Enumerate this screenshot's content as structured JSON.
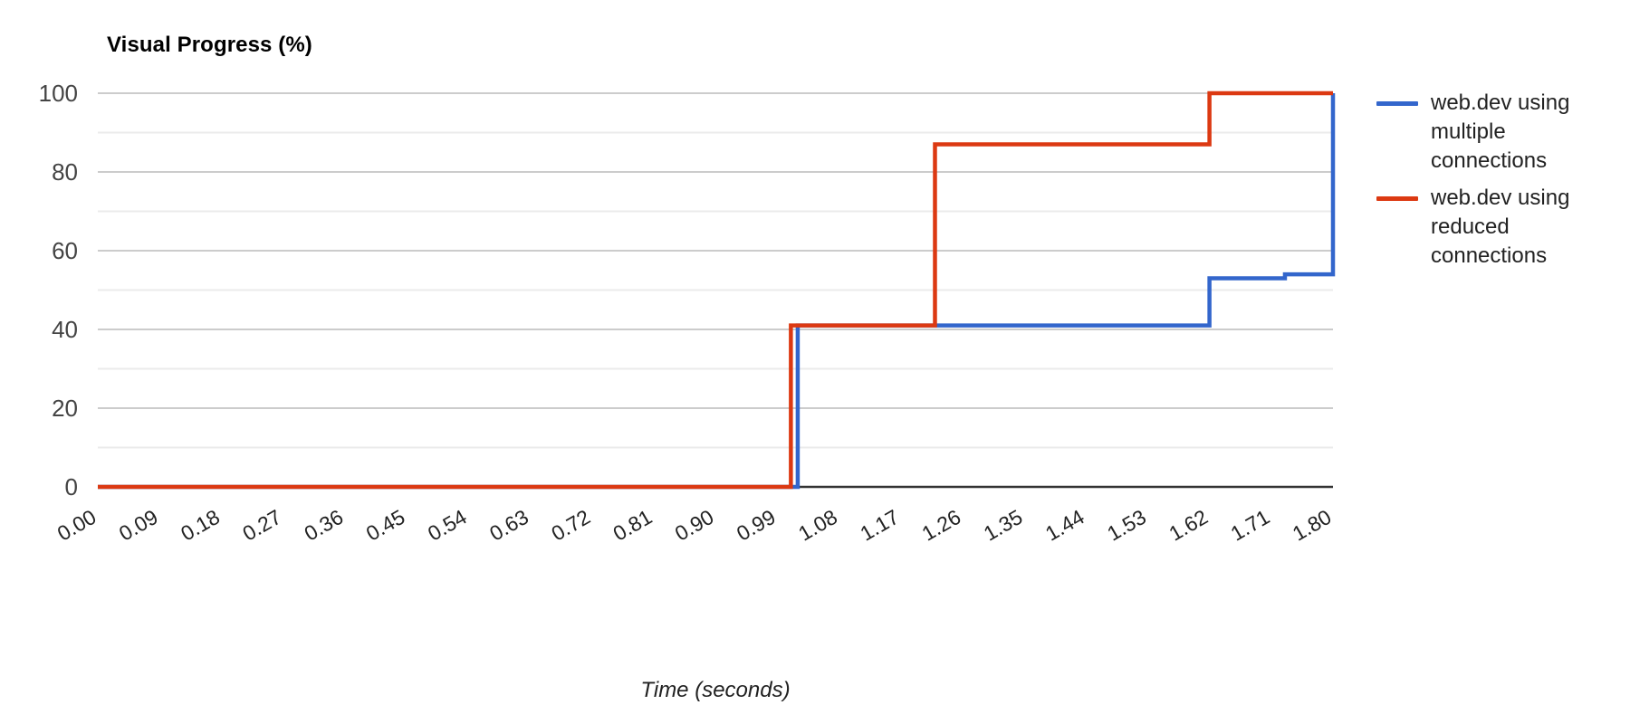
{
  "chart_data": {
    "type": "line",
    "title": "Visual Progress (%)",
    "subtitle": "",
    "xlabel": "Time (seconds)",
    "ylabel": "Visual Progress (%)",
    "xlim": [
      0.0,
      1.8
    ],
    "ylim": [
      0,
      100
    ],
    "grid": true,
    "legend_position": "right",
    "x_tick_labels": [
      "0.00",
      "0.09",
      "0.18",
      "0.27",
      "0.36",
      "0.45",
      "0.54",
      "0.63",
      "0.72",
      "0.81",
      "0.90",
      "0.99",
      "1.08",
      "1.17",
      "1.26",
      "1.35",
      "1.44",
      "1.53",
      "1.62",
      "1.71",
      "1.80"
    ],
    "x_tick_values": [
      0.0,
      0.09,
      0.18,
      0.27,
      0.36,
      0.45,
      0.54,
      0.63,
      0.72,
      0.81,
      0.9,
      0.99,
      1.08,
      1.17,
      1.26,
      1.35,
      1.44,
      1.53,
      1.62,
      1.71,
      1.8
    ],
    "y_tick_labels": [
      "0",
      "20",
      "40",
      "60",
      "80",
      "100"
    ],
    "y_tick_values": [
      0,
      20,
      40,
      60,
      80,
      100
    ],
    "y_minor_gridlines": [
      10,
      30,
      50,
      70,
      90
    ],
    "series": [
      {
        "name": "web.dev using multiple connections",
        "color": "#3366CC",
        "step": "post",
        "x": [
          0.0,
          0.99,
          1.02,
          1.59,
          1.62,
          1.7,
          1.73,
          1.79,
          1.8
        ],
        "values": [
          0,
          0,
          41,
          41,
          53,
          53,
          54,
          54,
          100
        ]
      },
      {
        "name": "web.dev using reduced connections",
        "color": "#DC3912",
        "step": "post",
        "x": [
          0.0,
          0.99,
          1.01,
          1.2,
          1.22,
          1.6,
          1.62,
          1.8
        ],
        "values": [
          0,
          0,
          41,
          41,
          87,
          87,
          100,
          100
        ]
      }
    ]
  },
  "legend": {
    "entries": [
      {
        "label": "web.dev using multiple connections",
        "color": "#3366CC"
      },
      {
        "label": "web.dev using reduced connections",
        "color": "#DC3912"
      }
    ]
  },
  "colors": {
    "series_blue": "#3366CC",
    "series_red": "#DC3912",
    "major_gridline": "#CCCCCC",
    "minor_gridline": "#EBEBEB",
    "axis_line": "#333333",
    "text": "#222222",
    "tick_text": "#444444"
  }
}
